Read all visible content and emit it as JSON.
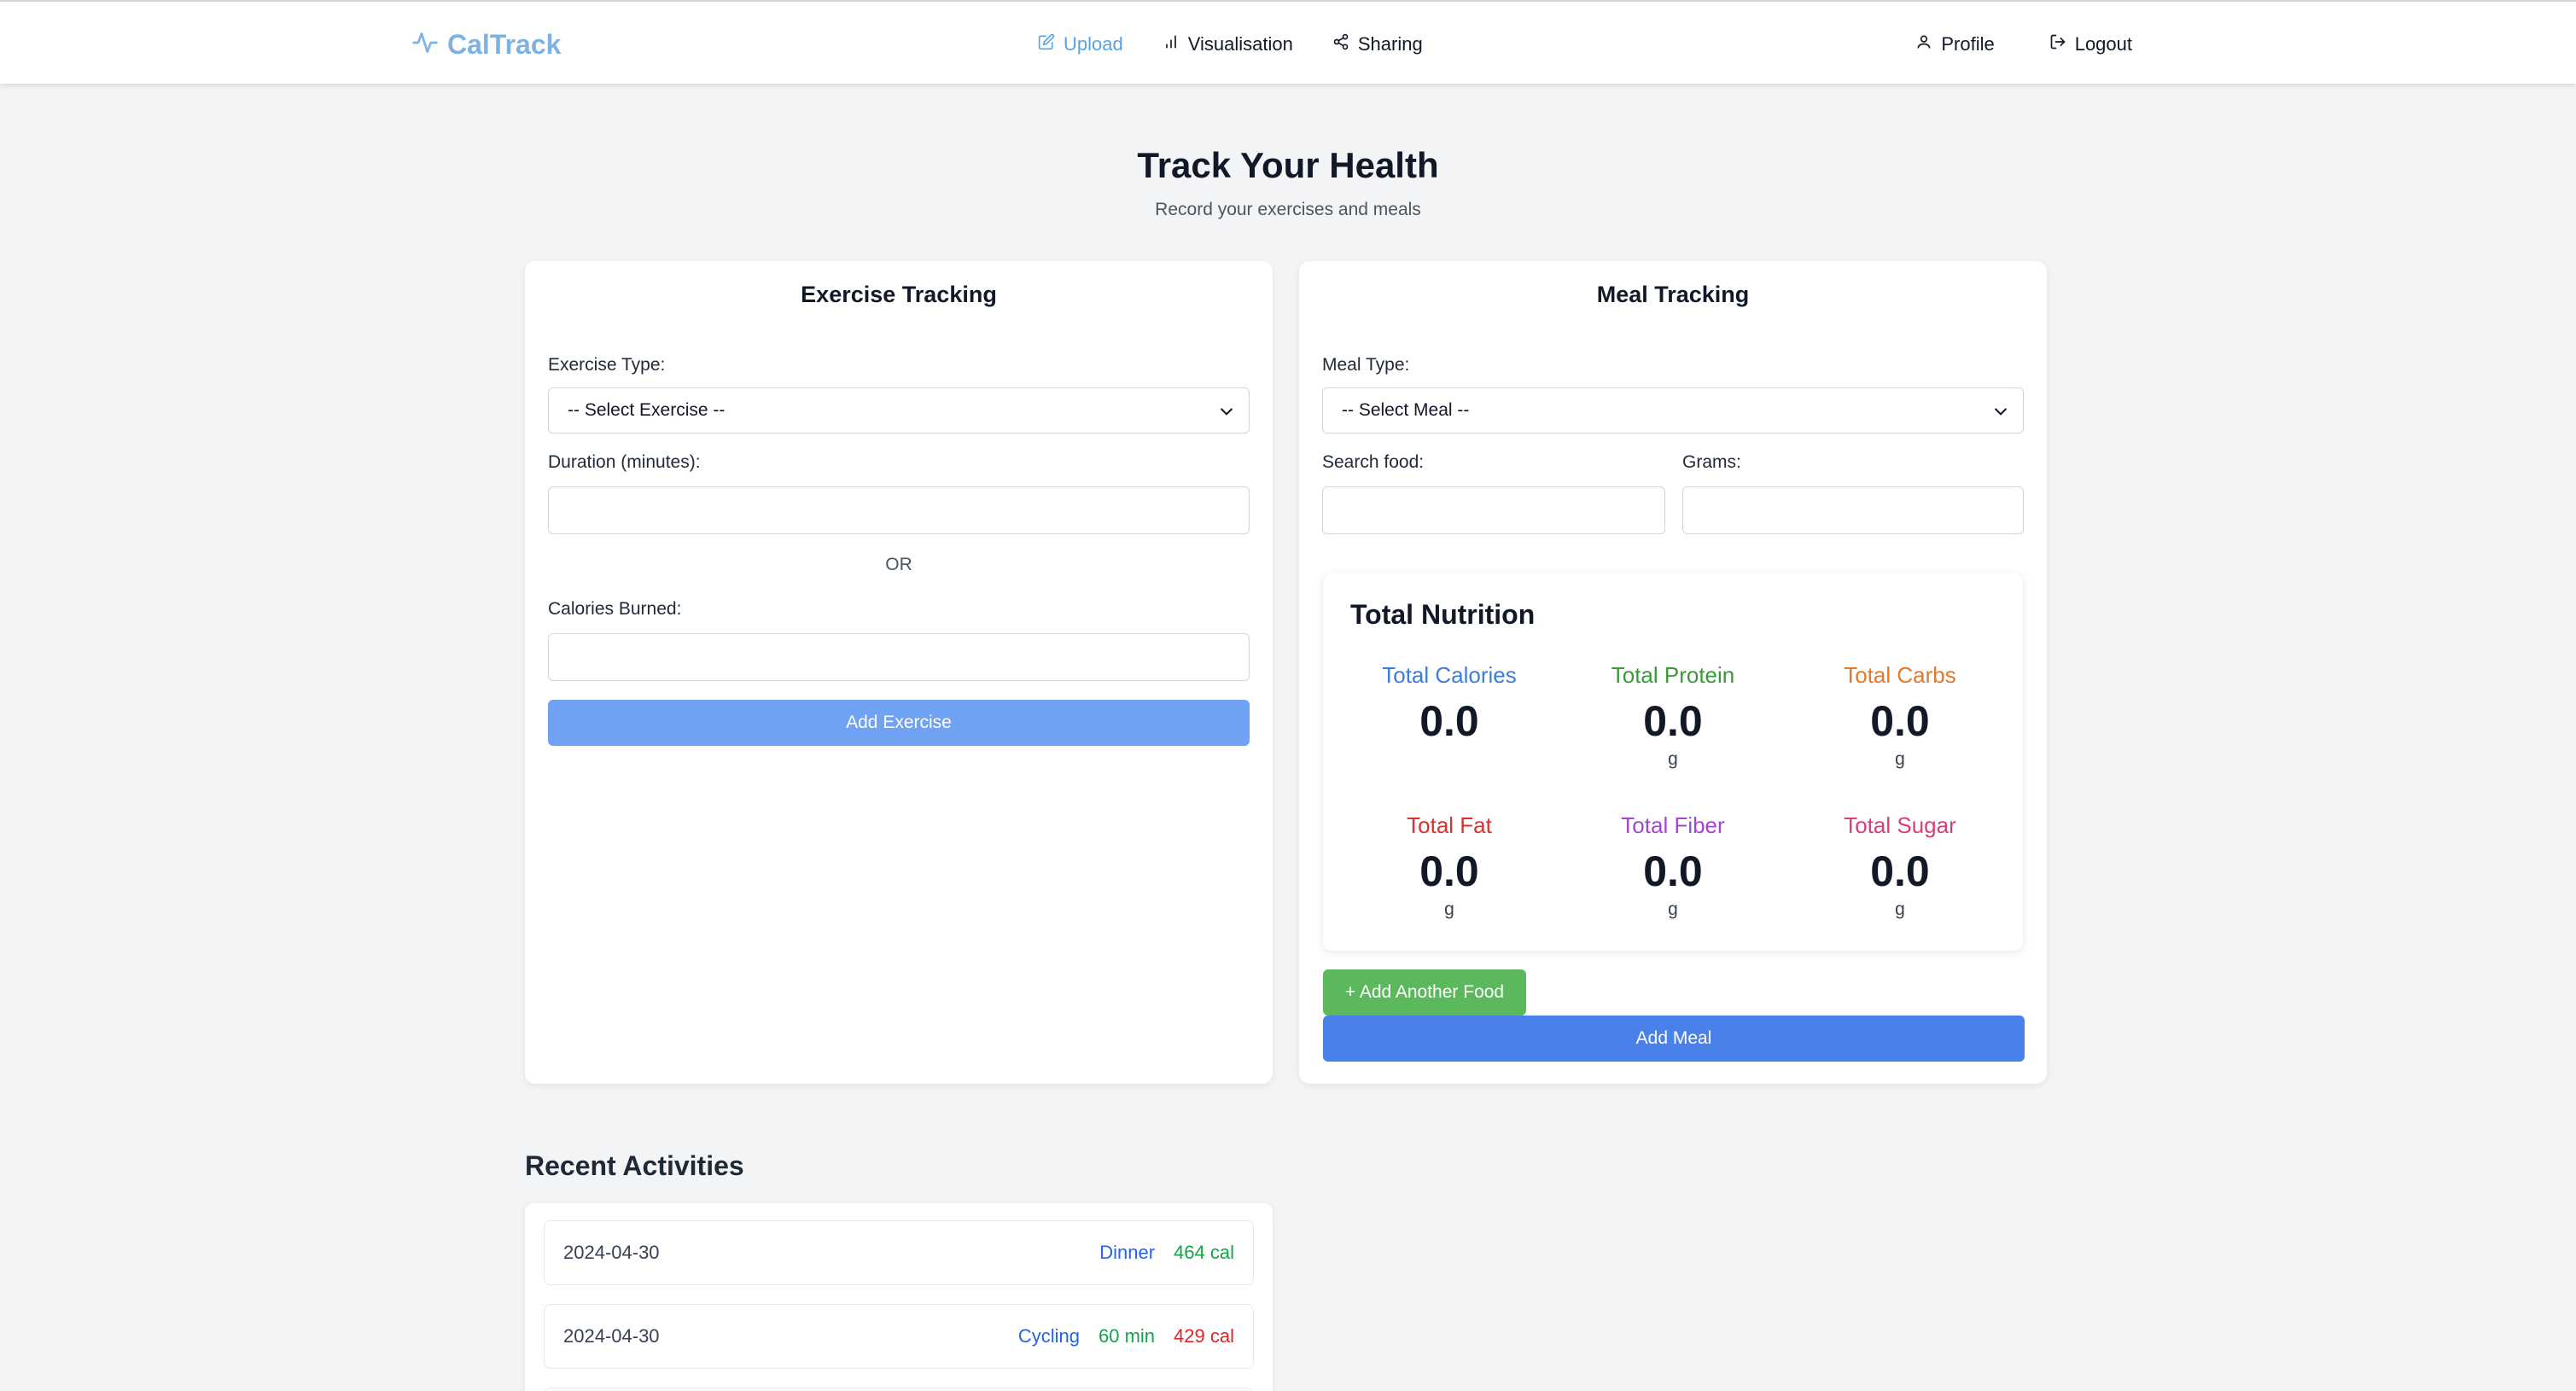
{
  "nav": {
    "logo": "CalTrack",
    "items": [
      {
        "label": "Upload",
        "icon": "edit-icon",
        "active": true
      },
      {
        "label": "Visualisation",
        "icon": "bar-chart-icon",
        "active": false
      },
      {
        "label": "Sharing",
        "icon": "share-icon",
        "active": false
      }
    ],
    "profile": "Profile",
    "logout": "Logout"
  },
  "hero": {
    "title": "Track Your Health",
    "subtitle": "Record your exercises and meals"
  },
  "exercise": {
    "title": "Exercise Tracking",
    "type_label": "Exercise Type:",
    "type_value": "-- Select Exercise --",
    "duration_label": "Duration (minutes):",
    "duration_value": "",
    "or": "OR",
    "calories_label": "Calories Burned:",
    "calories_value": "",
    "submit": "Add Exercise"
  },
  "meal": {
    "title": "Meal Tracking",
    "type_label": "Meal Type:",
    "type_value": "-- Select Meal --",
    "search_label": "Search food:",
    "search_value": "",
    "grams_label": "Grams:",
    "grams_value": "",
    "nutrition": {
      "title": "Total Nutrition",
      "items": [
        {
          "name": "Total Calories",
          "value": "0.0",
          "unit": "",
          "color": "#3b7dd8"
        },
        {
          "name": "Total Protein",
          "value": "0.0",
          "unit": "g",
          "color": "#3a9a3a"
        },
        {
          "name": "Total Carbs",
          "value": "0.0",
          "unit": "g",
          "color": "#e07a2c"
        },
        {
          "name": "Total Fat",
          "value": "0.0",
          "unit": "g",
          "color": "#dc2f2f"
        },
        {
          "name": "Total Fiber",
          "value": "0.0",
          "unit": "g",
          "color": "#a445d6"
        },
        {
          "name": "Total Sugar",
          "value": "0.0",
          "unit": "g",
          "color": "#d6407a"
        }
      ]
    },
    "add_food": "+ Add Another Food",
    "submit": "Add Meal"
  },
  "recent": {
    "title": "Recent Activities",
    "items": [
      {
        "date": "2024-04-30",
        "name": "Dinner",
        "duration": "",
        "calories": "464 cal",
        "cal_color": "green"
      },
      {
        "date": "2024-04-30",
        "name": "Cycling",
        "duration": "60 min",
        "calories": "429 cal",
        "cal_color": "red"
      }
    ]
  },
  "colors": {
    "accent": "#5aa3e0",
    "exercise_button": "#6fa2f2",
    "meal_button": "#4a80ea",
    "add_food_button": "#5cb85c",
    "page_bg": "#f3f4f6"
  }
}
